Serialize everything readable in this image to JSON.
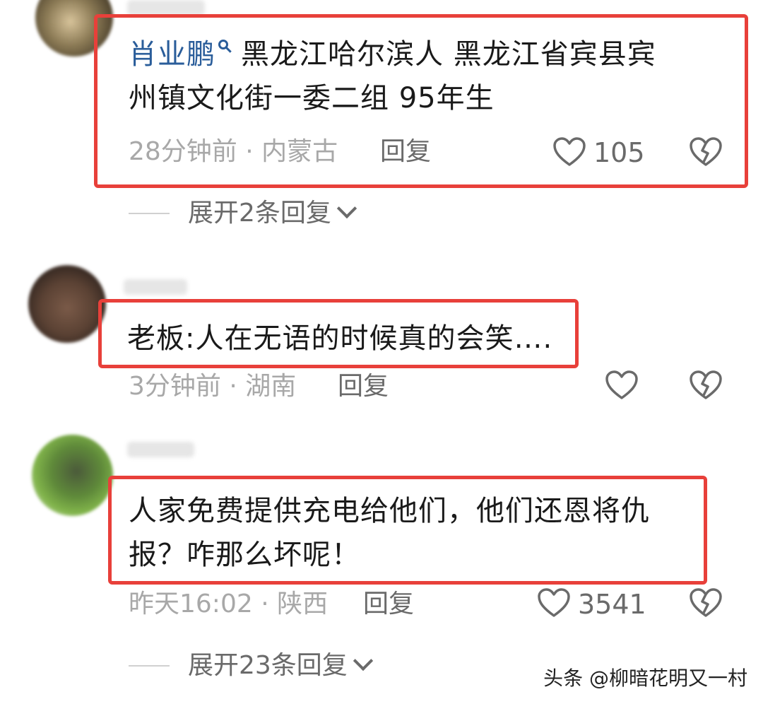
{
  "comments": [
    {
      "author": "肖业鹏",
      "text_line1": "黑龙江哈尔滨人 黑龙江省宾县宾",
      "text_line2": "州镇文化街一委二组 95年生",
      "time_location": "28分钟前 · 内蒙古",
      "reply_label": "回复",
      "like_count": "105",
      "expand_label": "展开2条回复"
    },
    {
      "text": "老板:人在无语的时候真的会笑…",
      "trailing": ".",
      "time_location": "3分钟前 · 湖南",
      "reply_label": "回复"
    },
    {
      "text_line1": "人家免费提供充电给他们，他们还恩将仇",
      "text_line2": "报？咋那么坏呢！",
      "time_location": "昨天16:02 · 陕西",
      "reply_label": "回复",
      "like_count": "3541",
      "expand_label": "展开23条回复"
    }
  ],
  "watermark": "头条 @柳暗花明又一村",
  "colors": {
    "highlight": "#e8403a",
    "author_link": "#2a5d9a",
    "meta_gray": "#a8a8a8"
  },
  "icons": [
    "search-icon",
    "heart-icon",
    "broken-heart-icon",
    "chevron-down-icon"
  ]
}
